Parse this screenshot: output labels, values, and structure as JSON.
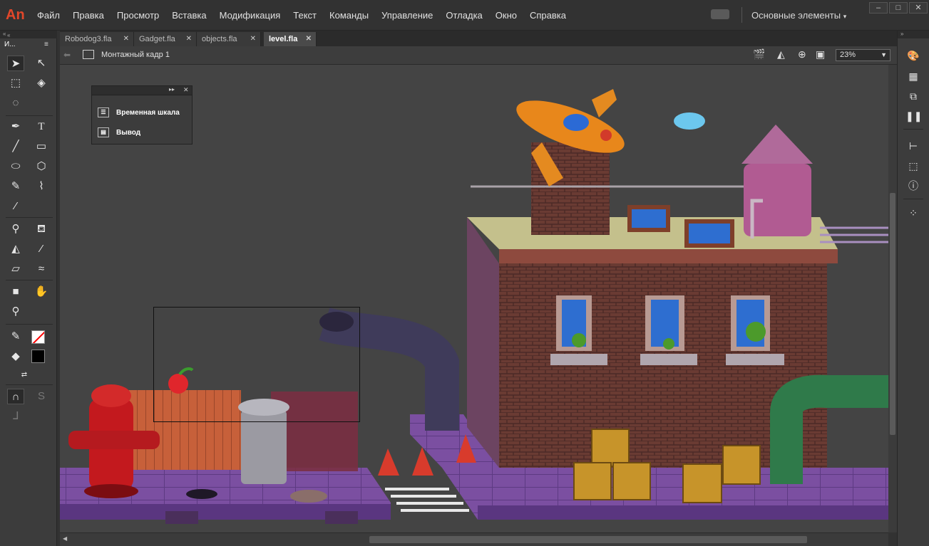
{
  "app": {
    "logo": "An"
  },
  "menu": [
    "Файл",
    "Правка",
    "Просмотр",
    "Вставка",
    "Модификация",
    "Текст",
    "Команды",
    "Управление",
    "Отладка",
    "Окно",
    "Справка"
  ],
  "workspace": "Основные элементы",
  "window_buttons": {
    "minimize": "–",
    "maximize": "□",
    "close": "✕"
  },
  "toolbar_header": "И...",
  "tabs": [
    {
      "label": "Robodog3.fla",
      "close": "✕"
    },
    {
      "label": "Gadget.fla",
      "close": "✕"
    },
    {
      "label": "objects.fla",
      "close": "✕"
    },
    {
      "label": "level.fla",
      "close": "✕",
      "active": true
    }
  ],
  "scene": {
    "label": "Монтажный кадр 1",
    "zoom": "23%"
  },
  "float_panel": {
    "items": [
      "Временная шкала",
      "Вывод"
    ]
  },
  "colors": {
    "accent": "#e2472a",
    "stage_bg": "#444444",
    "panel_bg": "#3c3c3c",
    "stroke": "#ff0000",
    "fill": "#000000"
  }
}
